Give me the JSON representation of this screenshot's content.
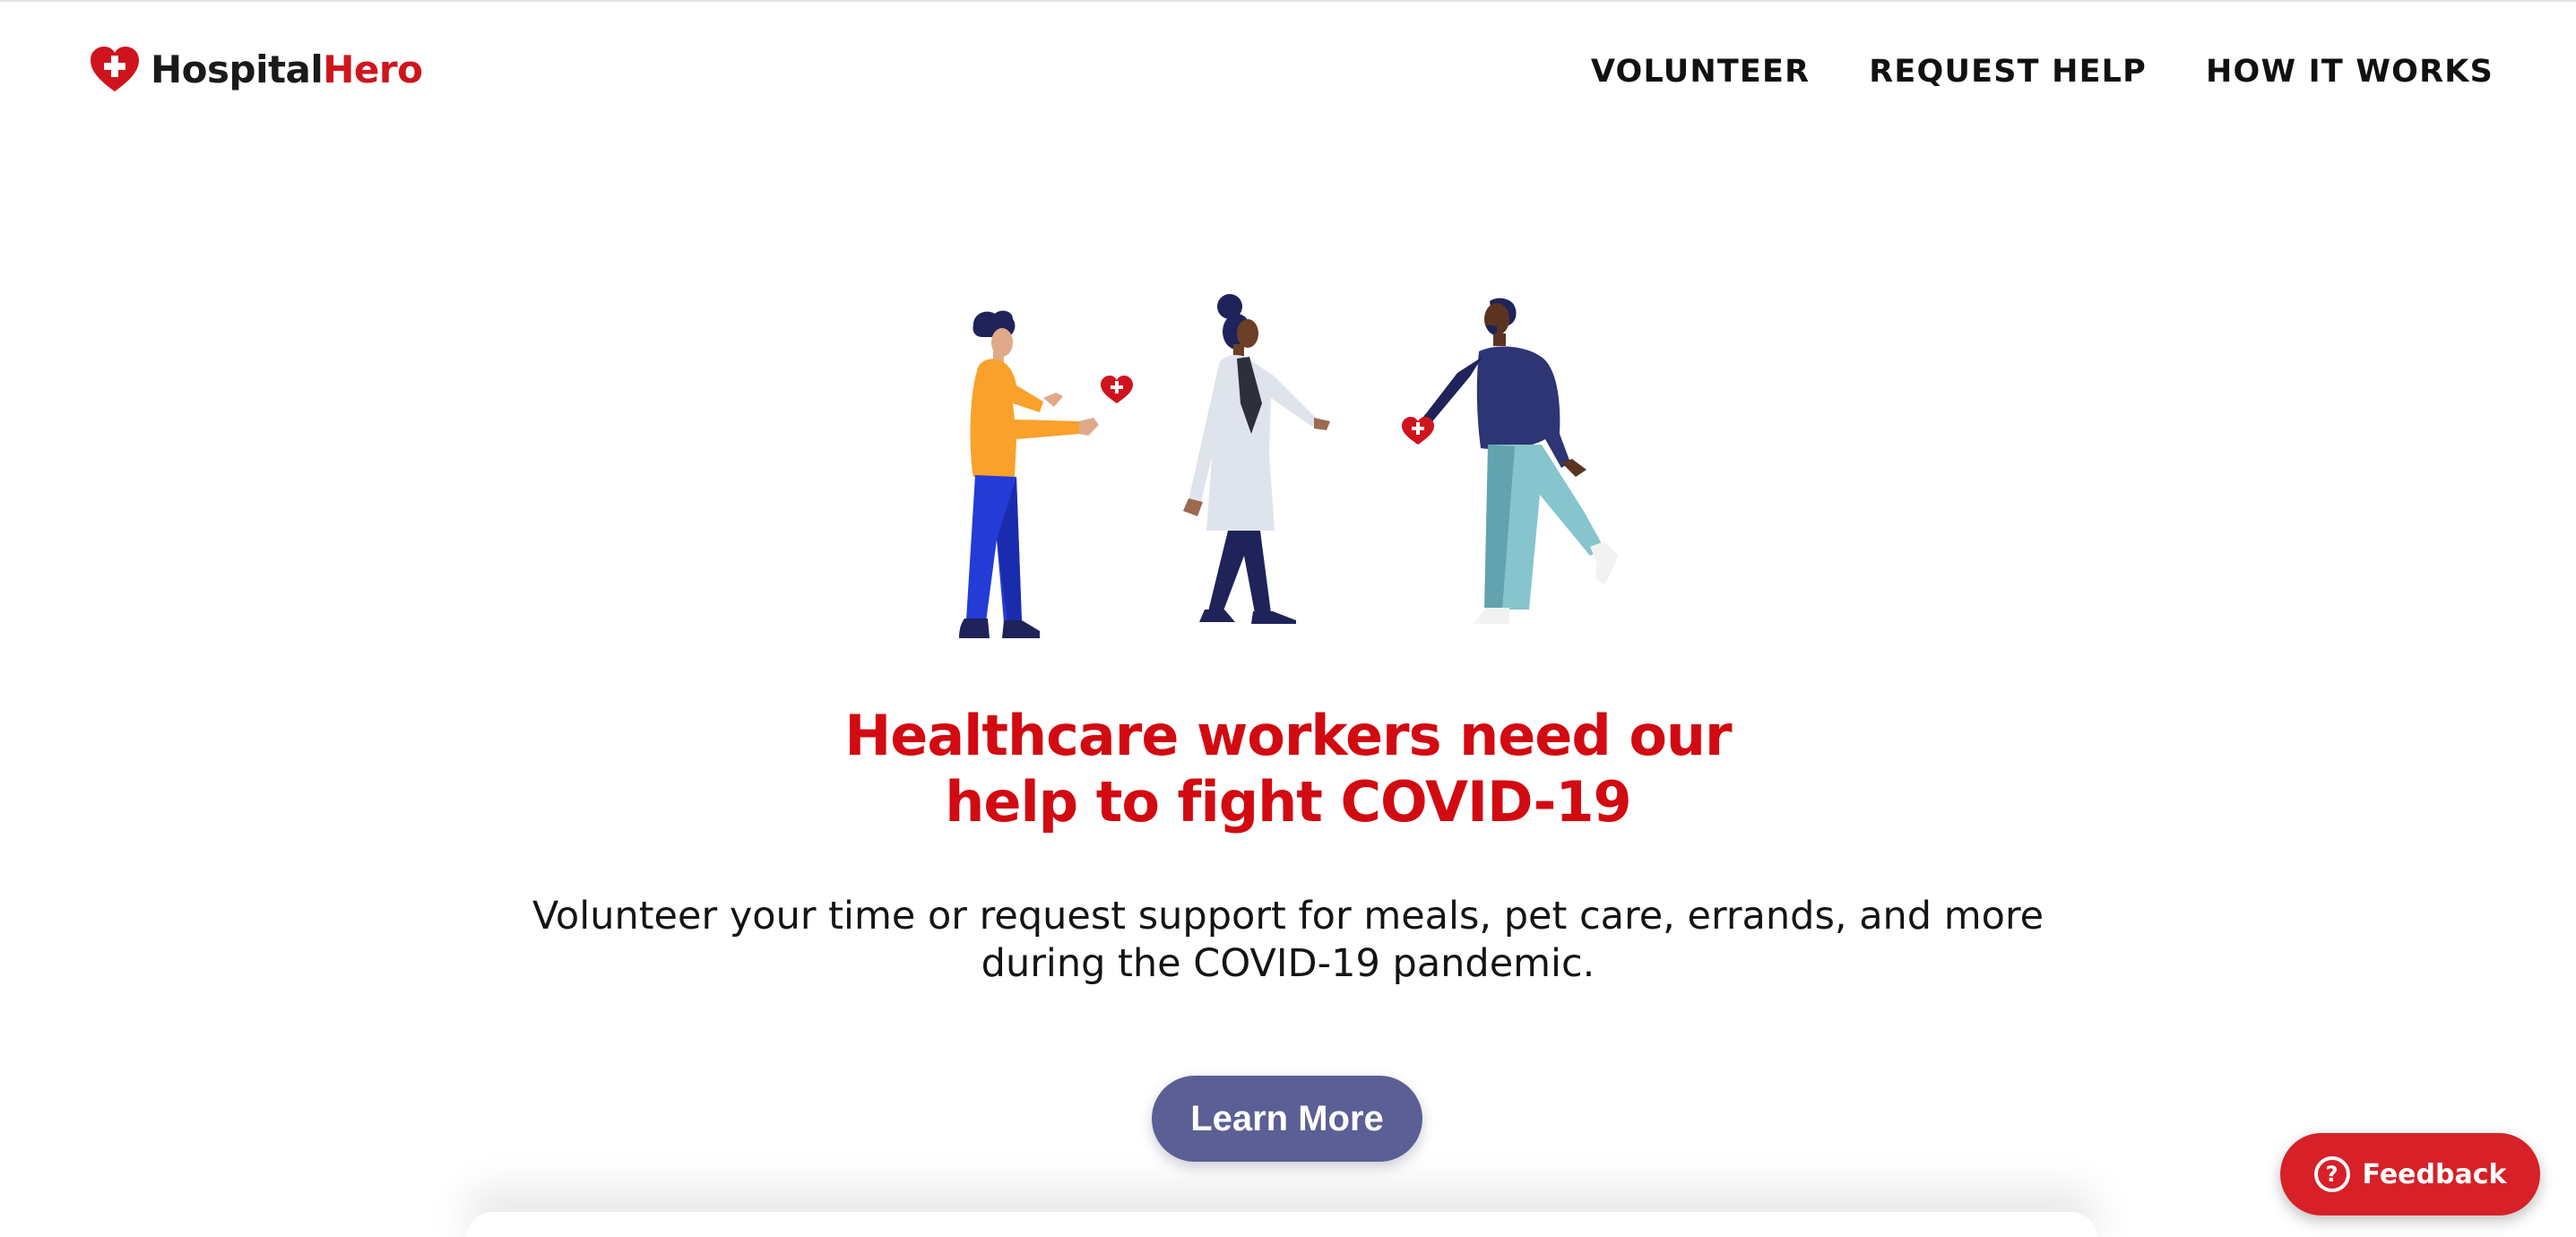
{
  "header": {
    "logo": {
      "part1": "Hospital",
      "part2": "Hero",
      "icon": "heart-cross-icon"
    },
    "nav": [
      {
        "label": "VOLUNTEER"
      },
      {
        "label": "REQUEST HELP"
      },
      {
        "label": "HOW IT WORKS"
      }
    ]
  },
  "hero": {
    "illustration": "people-helping-illustration",
    "headline": [
      "Healthcare workers need our",
      "help to fight COVID-19"
    ],
    "subtext": [
      "Volunteer your time or request support for meals, pet care, errands, and more",
      "during the COVID-19 pandemic."
    ],
    "cta_label": "Learn More"
  },
  "feedback": {
    "label": "Feedback",
    "icon": "question-circle-icon"
  },
  "colors": {
    "brand_red": "#d0141d",
    "headline_red": "#d20a11",
    "cta_bg": "#5b5f95",
    "feedback_bg": "#d72027"
  }
}
